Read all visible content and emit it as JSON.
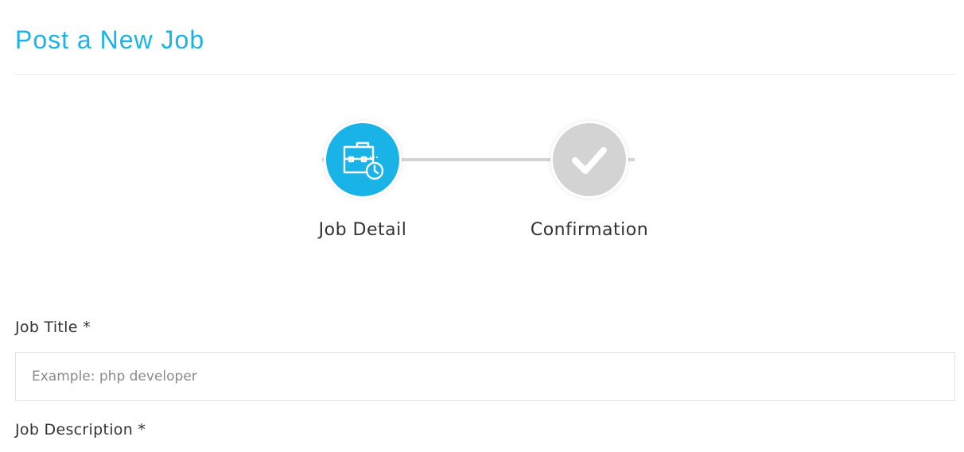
{
  "header": {
    "title": "Post a New Job"
  },
  "stepper": {
    "steps": [
      {
        "label": "Job Detail",
        "icon": "briefcase-clock-icon",
        "status": "active"
      },
      {
        "label": "Confirmation",
        "icon": "checkmark-icon",
        "status": "inactive"
      }
    ]
  },
  "form": {
    "job_title": {
      "label": "Job Title *",
      "placeholder": "Example: php developer",
      "value": ""
    },
    "job_description": {
      "label": "Job Description *"
    }
  },
  "colors": {
    "accent": "#1ab3e8",
    "inactive_step": "#d3d3d3",
    "track": "#d4d4d4",
    "text": "#333333"
  }
}
